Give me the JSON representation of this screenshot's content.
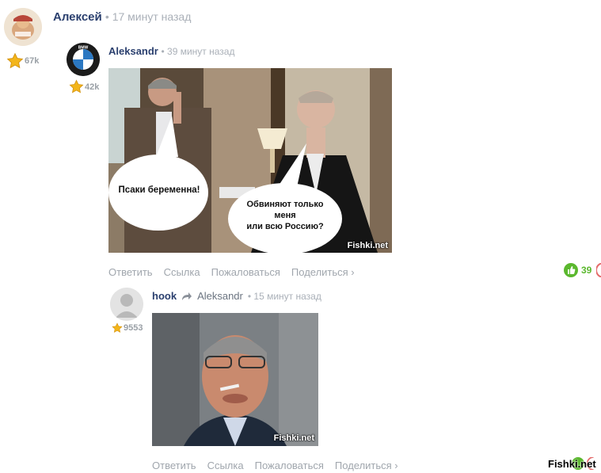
{
  "comments": [
    {
      "author": "Алексей",
      "time": "• 17 минут назад",
      "rating": "67k"
    },
    {
      "author": "Aleksandr",
      "time": "• 39 минут назад",
      "rating": "42k",
      "avatar_logo": "BMW",
      "image": {
        "bubble_left": "Псаки беременна!",
        "bubble_right_line1": "Обвиняют только",
        "bubble_right_line2": "меня",
        "bubble_right_line3": "или всю Россию?",
        "watermark": "Fishki.net"
      },
      "actions": [
        "Ответить",
        "Ссылка",
        "Пожаловаться",
        "Поделиться ›"
      ],
      "likes": "39"
    },
    {
      "author": "hook",
      "reply_to": "Aleksandr",
      "time": "• 15 минут назад",
      "rating": "9553",
      "image": {
        "watermark": "Fishki.net"
      },
      "actions": [
        "Ответить",
        "Ссылка",
        "Пожаловаться",
        "Поделиться ›"
      ]
    }
  ],
  "page_watermark": "Fishki.net",
  "icons": [
    "star-icon",
    "reply-arrow-icon",
    "thumbs-up-icon",
    "share-chevron-icon"
  ],
  "colors": {
    "author": "#2a3f6e",
    "meta": "#aab0b8",
    "like": "#5bb82e",
    "star": "#f3b51a"
  }
}
